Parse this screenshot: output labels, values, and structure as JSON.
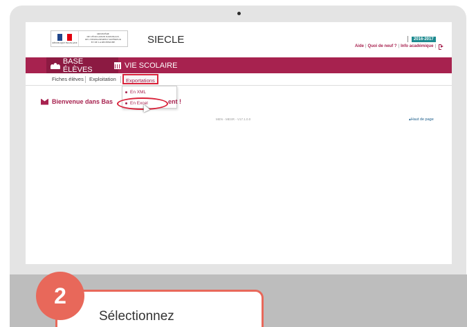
{
  "header": {
    "ministry_text": "MINISTÈRE\nDE L'ÉDUCATION NATIONALE,\nDE L'ENSEIGNEMENT SUPÉRIEUR\nET DE LA RECHERCHE",
    "flag_caption": "RÉPUBLIQUE FRANÇAISE",
    "app_title": "SIECLE",
    "year": "2016-2017",
    "links": [
      "Aide",
      "Quoi de neuf ?",
      "Info académique"
    ]
  },
  "nav": {
    "items": [
      {
        "label": "BASE ÉLÈVES",
        "icon": "people-icon",
        "active": true
      },
      {
        "label": "VIE SCOLAIRE",
        "icon": "calendar-icon",
        "active": false
      }
    ]
  },
  "subnav": {
    "items": [
      "Fiches élèves",
      "Exploitation",
      "Exportations"
    ]
  },
  "dropdown": {
    "items": [
      "En XML",
      "En Excel"
    ]
  },
  "welcome": {
    "text_left": "Bienvenue dans Bas",
    "text_right": "ent !"
  },
  "footer": {
    "version": "MEN - MESR - V17.1.0.0",
    "top_link": "Haut de page"
  },
  "tutorial": {
    "step": "2",
    "text": "Sélectionnez"
  },
  "colors": {
    "brand": "#a7224f",
    "annotation": "#d9223a",
    "step_badge": "#e8685a",
    "year_badge": "#1d8a8f"
  }
}
